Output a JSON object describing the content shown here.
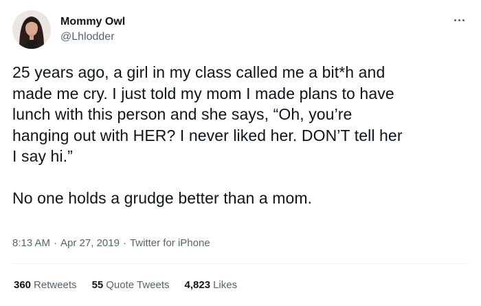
{
  "author": {
    "display_name": "Mommy Owl",
    "handle": "@Lhlodder"
  },
  "more_icon": "more-horizontal-icon",
  "tweet": {
    "text": "25 years ago, a girl in my class called me a bit*h and\nmade me cry. I just told my mom I made plans to have\nlunch with this person and she says, “Oh, you’re\nhanging out with HER? I never liked her. DON’T tell her\nI say hi.”\n\nNo one holds a grudge better than a mom."
  },
  "meta": {
    "time": "8:13 AM",
    "separator": "·",
    "date": "Apr 27, 2019",
    "source": "Twitter for iPhone"
  },
  "stats": {
    "retweets": {
      "count": "360",
      "label": "Retweets"
    },
    "quote_tweets": {
      "count": "55",
      "label": "Quote Tweets"
    },
    "likes": {
      "count": "4,823",
      "label": "Likes"
    }
  },
  "colors": {
    "text_primary": "#0f1419",
    "text_secondary": "#536471",
    "divider": "#eff3f4",
    "background": "#ffffff"
  }
}
